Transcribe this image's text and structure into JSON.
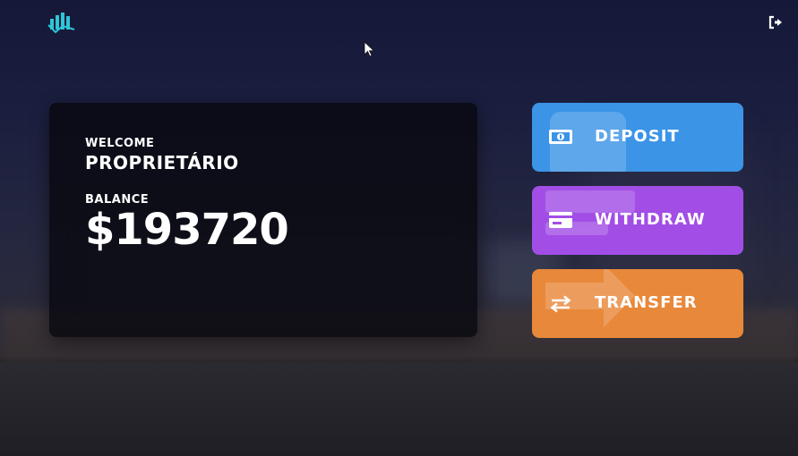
{
  "header": {
    "logo_icon": "bar-chart-logo-icon",
    "logout_icon": "sign-out-icon"
  },
  "account": {
    "welcome_label": "WELCOME",
    "user_name": "PROPRIETÁRIO",
    "balance_label": "BALANCE",
    "balance_value": "$193720"
  },
  "actions": {
    "deposit": {
      "label": "DEPOSIT",
      "icon": "money-bill-icon",
      "color": "#3b94e6"
    },
    "withdraw": {
      "label": "WITHDRAW",
      "icon": "credit-card-icon",
      "color": "#a24ee6"
    },
    "transfer": {
      "label": "TRANSFER",
      "icon": "exchange-arrows-icon",
      "color": "#e8883a"
    }
  },
  "colors": {
    "logo_accent": "#2fc5d6",
    "card_background": "#08080f"
  }
}
